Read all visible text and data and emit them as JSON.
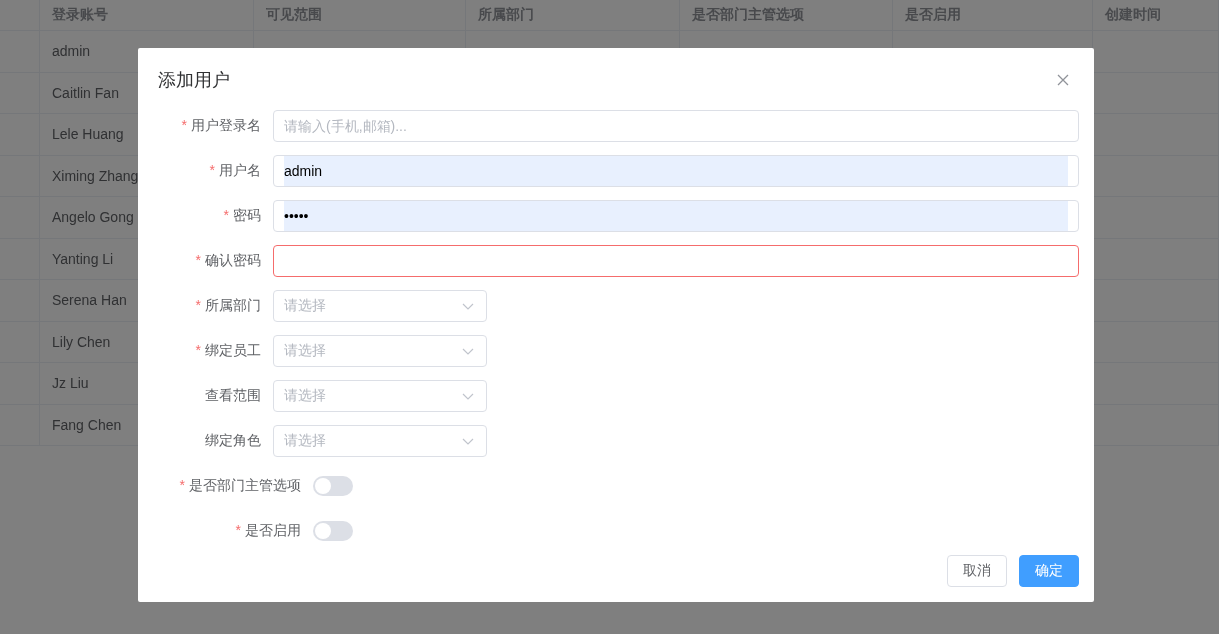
{
  "table": {
    "columns": [
      {
        "label": "登录账号"
      },
      {
        "label": "可见范围"
      },
      {
        "label": "所属部门"
      },
      {
        "label": "是否部门主管选项"
      },
      {
        "label": "是否启用"
      },
      {
        "label": "创建时间"
      }
    ],
    "rows": [
      {
        "account": "admin"
      },
      {
        "account": "Caitlin Fan"
      },
      {
        "account": "Lele Huang"
      },
      {
        "account": "Ximing Zhang"
      },
      {
        "account": "Angelo Gong"
      },
      {
        "account": "Yanting Li"
      },
      {
        "account": "Serena Han"
      },
      {
        "account": "Lily Chen"
      },
      {
        "account": "Jz Liu"
      },
      {
        "account": "Fang Chen"
      }
    ]
  },
  "dialog": {
    "title": "添加用户",
    "fields": [
      {
        "kind": "text",
        "label": "用户登录名",
        "required_mark": "*",
        "placeholder": "请输入(手机,邮箱)...",
        "autofilled": false,
        "error": false
      },
      {
        "kind": "text",
        "label": "用户名",
        "required_mark": "*",
        "value": "admin",
        "autofilled": true,
        "error": false
      },
      {
        "kind": "text",
        "label": "密码",
        "required_mark": "*",
        "value": "•••••",
        "autofilled": true,
        "error": false
      },
      {
        "kind": "text",
        "label": "确认密码",
        "required_mark": "*",
        "autofilled": false,
        "error": true
      },
      {
        "kind": "select",
        "label": "所属部门",
        "required_mark": "*",
        "placeholder": "请选择"
      },
      {
        "kind": "select",
        "label": "绑定员工",
        "required_mark": "*",
        "placeholder": "请选择"
      },
      {
        "kind": "select",
        "label": "查看范围",
        "placeholder": "请选择"
      },
      {
        "kind": "select",
        "label": "绑定角色",
        "placeholder": "请选择"
      },
      {
        "kind": "switch",
        "label": "是否部门主管选项",
        "required_mark": "*",
        "on": false
      },
      {
        "kind": "switch",
        "label": "是否启用",
        "required_mark": "*",
        "on": false
      }
    ],
    "buttons": [
      {
        "label": "取消",
        "kind": "default"
      },
      {
        "label": "确定",
        "kind": "primary"
      }
    ]
  }
}
